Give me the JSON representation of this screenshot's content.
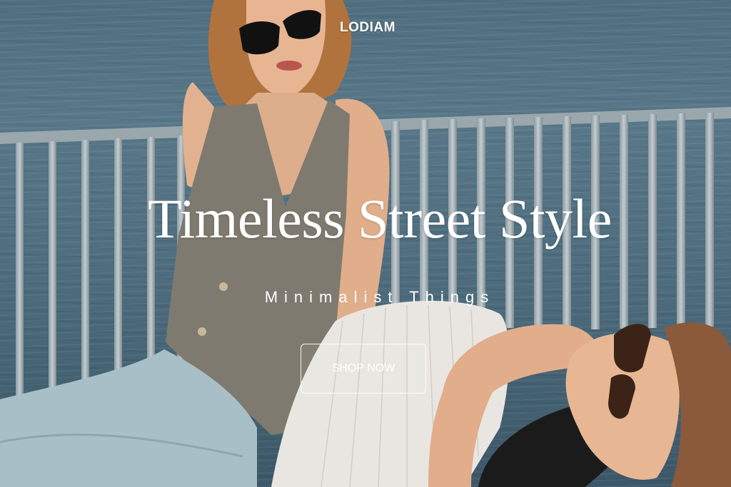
{
  "header": {
    "brand": "LODIAM"
  },
  "hero": {
    "headline": "Timeless Street Style",
    "subheadline": "Minimalist Things",
    "cta_label": "SHOP NOW"
  },
  "colors": {
    "text": "#ffffff",
    "water": "#587889"
  }
}
